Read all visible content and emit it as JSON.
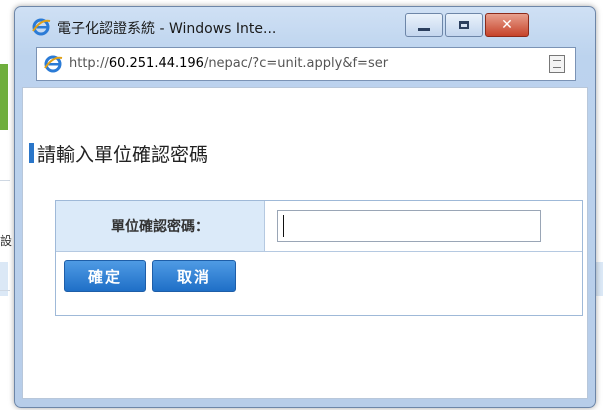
{
  "window": {
    "title": "電子化認證系統 - Windows Inte...",
    "url_prefix": "http://",
    "url_host": "60.251.44.196",
    "url_path": "/nepac/?c=unit.apply&f=ser"
  },
  "page": {
    "heading": "請輸入單位確認密碼"
  },
  "form": {
    "password_label": "單位確認密碼：",
    "password_value": "",
    "ok_label": "確定",
    "cancel_label": "取消"
  },
  "background": {
    "side_char": "設"
  },
  "colors": {
    "accent": "#2a76c9",
    "button": "#1f6fc7",
    "label_bg": "#dbeaf9",
    "close_button": "#c6432a"
  }
}
